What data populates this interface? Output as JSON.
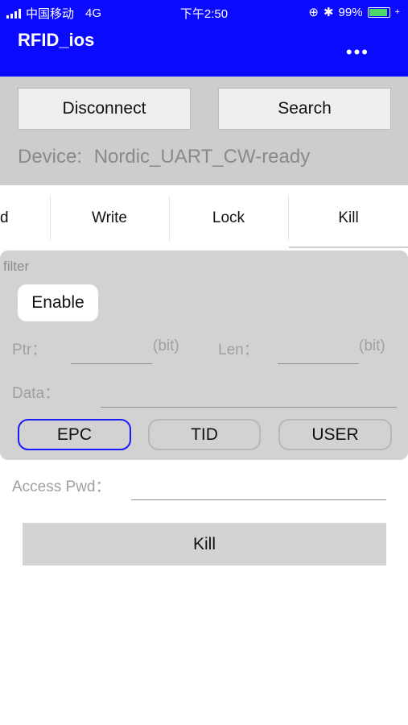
{
  "status_bar": {
    "carrier": "中国移动",
    "network": "4G",
    "time": "下午2:50",
    "battery": "99%",
    "battery_level": 0.99,
    "signal_bars": 4
  },
  "header": {
    "title": "RFID_ios",
    "more_label": "•••"
  },
  "connection": {
    "disconnect_label": "Disconnect",
    "search_label": "Search",
    "device_prefix": "Device:",
    "device_name": "Nordic_UART_CW-ready"
  },
  "tabs": [
    {
      "label": "d"
    },
    {
      "label": "Write"
    },
    {
      "label": "Lock"
    },
    {
      "label": "Kill",
      "selected": true
    }
  ],
  "filter": {
    "section_label": "filter",
    "enable_label": "Enable",
    "ptr_label": "Ptr：",
    "ptr_unit": "(bit)",
    "ptr_value": "",
    "len_label": "Len：",
    "len_unit": "(bit)",
    "len_value": "",
    "data_label": "Data：",
    "data_value": "",
    "banks": [
      "EPC",
      "TID",
      "USER"
    ],
    "selected_bank": "EPC"
  },
  "kill": {
    "access_pwd_label": "Access Pwd：",
    "access_pwd_value": "",
    "kill_button_label": "Kill"
  },
  "colors": {
    "header_bg": "#0a0aff",
    "panel_bg": "#d2d2d2",
    "selected_border": "#1a1aff"
  }
}
